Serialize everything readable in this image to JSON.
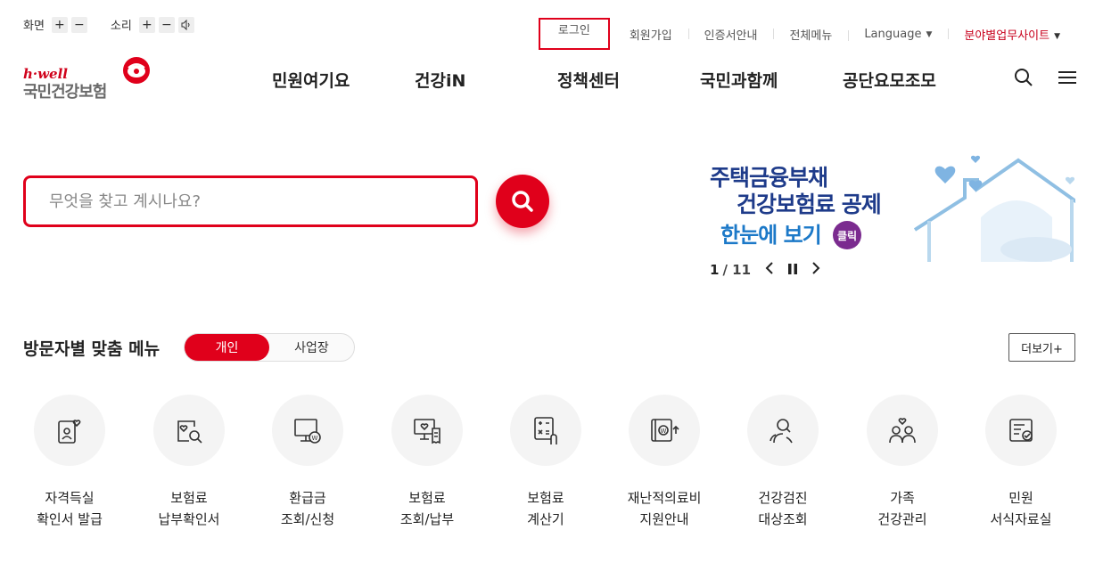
{
  "util": {
    "screen_label": "화면",
    "sound_label": "소리",
    "plus": "+",
    "minus": "−"
  },
  "top_links": {
    "login": "로그인",
    "join": "회원가입",
    "cert": "인증서안내",
    "all_menu": "전체메뉴",
    "language": "Language",
    "field_sites": "분야별업무사이트"
  },
  "logo": {
    "sub": "h·well",
    "main": "국민건강보험"
  },
  "gnb": [
    "민원여기요",
    "건강iN",
    "정책센터",
    "국민과함께",
    "공단요모조모"
  ],
  "search": {
    "placeholder": "무엇을 찾고 계시나요?"
  },
  "banner": {
    "line1": "주택금융부채",
    "line2": "건강보험료 공제",
    "line3": "한눈에 보기",
    "badge": "클릭",
    "current": "1",
    "total": "/ 11"
  },
  "visitor": {
    "title": "방문자별 맞춤 메뉴",
    "tab_personal": "개인",
    "tab_business": "사업장",
    "more": "더보기+"
  },
  "menus": [
    {
      "label": "자격득실\n확인서 발급",
      "icon": "id-card-heart-icon"
    },
    {
      "label": "보험료\n납부확인서",
      "icon": "document-search-icon"
    },
    {
      "label": "환급금\n조회/신청",
      "icon": "monitor-won-icon"
    },
    {
      "label": "보험료\n조회/납부",
      "icon": "monitor-receipt-icon"
    },
    {
      "label": "보험료\n계산기",
      "icon": "calculator-hand-icon"
    },
    {
      "label": "재난적의료비\n지원안내",
      "icon": "wallet-won-icon"
    },
    {
      "label": "건강검진\n대상조회",
      "icon": "people-search-icon"
    },
    {
      "label": "가족\n건강관리",
      "icon": "family-heart-icon"
    },
    {
      "label": "민원\n서식자료실",
      "icon": "form-check-icon"
    }
  ],
  "colors": {
    "brand_red": "#e0001b",
    "banner_navy": "#1e3b8a",
    "banner_blue": "#1c79c8"
  }
}
